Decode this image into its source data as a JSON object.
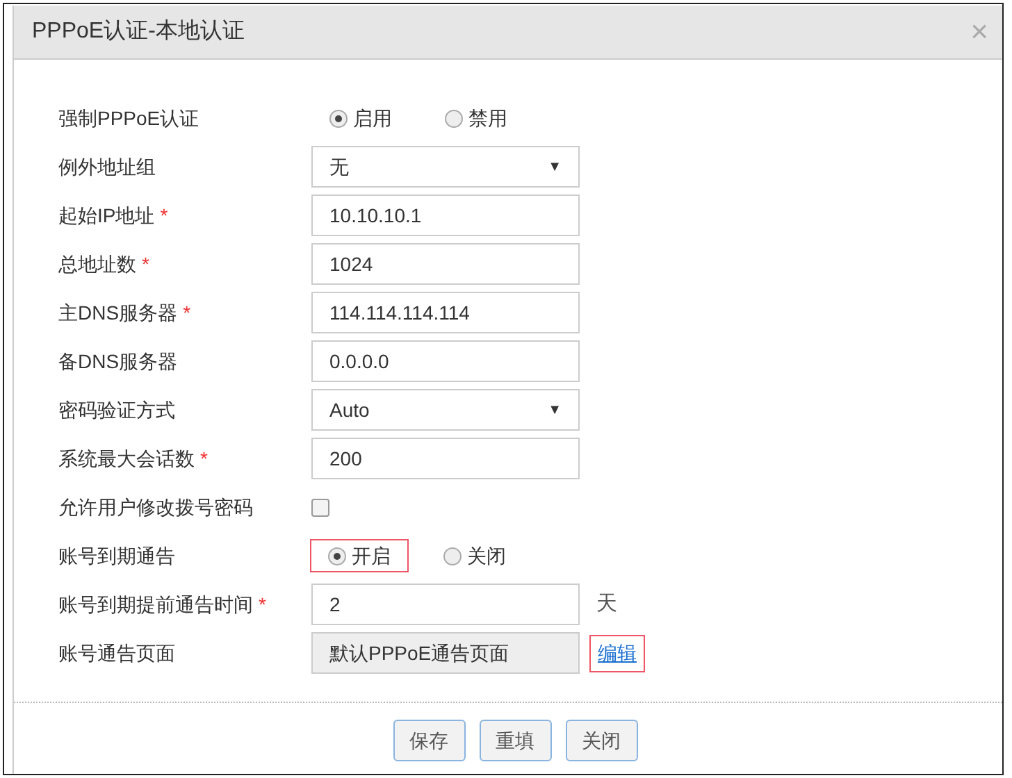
{
  "dialog": {
    "title": "PPPoE认证-本地认证",
    "close": "×"
  },
  "fields": [
    {
      "kind": "radio",
      "label": "强制PPPoE认证",
      "options": [
        {
          "label": "启用",
          "selected": true,
          "highlighted": false
        },
        {
          "label": "禁用",
          "selected": false,
          "highlighted": false
        }
      ]
    },
    {
      "kind": "select",
      "label": "例外地址组",
      "value": "无",
      "caret": "▼"
    },
    {
      "kind": "input",
      "label": "起始IP地址",
      "required_mark": "*",
      "value": "10.10.10.1"
    },
    {
      "kind": "input",
      "label": "总地址数",
      "required_mark": "*",
      "value": "1024"
    },
    {
      "kind": "input",
      "label": "主DNS服务器",
      "required_mark": "*",
      "value": "114.114.114.114"
    },
    {
      "kind": "input",
      "label": "备DNS服务器",
      "value": "0.0.0.0"
    },
    {
      "kind": "select",
      "label": "密码验证方式",
      "value": "Auto",
      "caret": "▼"
    },
    {
      "kind": "input",
      "label": "系统最大会话数",
      "required_mark": "*",
      "value": "200"
    },
    {
      "kind": "checkbox",
      "label": "允许用户修改拨号密码",
      "checked": false
    },
    {
      "kind": "radio",
      "label": "账号到期通告",
      "options": [
        {
          "label": "开启",
          "selected": true,
          "highlighted": true
        },
        {
          "label": "关闭",
          "selected": false,
          "highlighted": false
        }
      ]
    },
    {
      "kind": "input",
      "label": "账号到期提前通告时间",
      "required_mark": "*",
      "value": "2",
      "unit": "天"
    },
    {
      "kind": "readonly",
      "label": "账号通告页面",
      "value": "默认PPPoE通告页面",
      "link": {
        "label": "编辑",
        "highlighted": true
      }
    }
  ],
  "buttons": [
    "保存",
    "重填",
    "关闭"
  ]
}
